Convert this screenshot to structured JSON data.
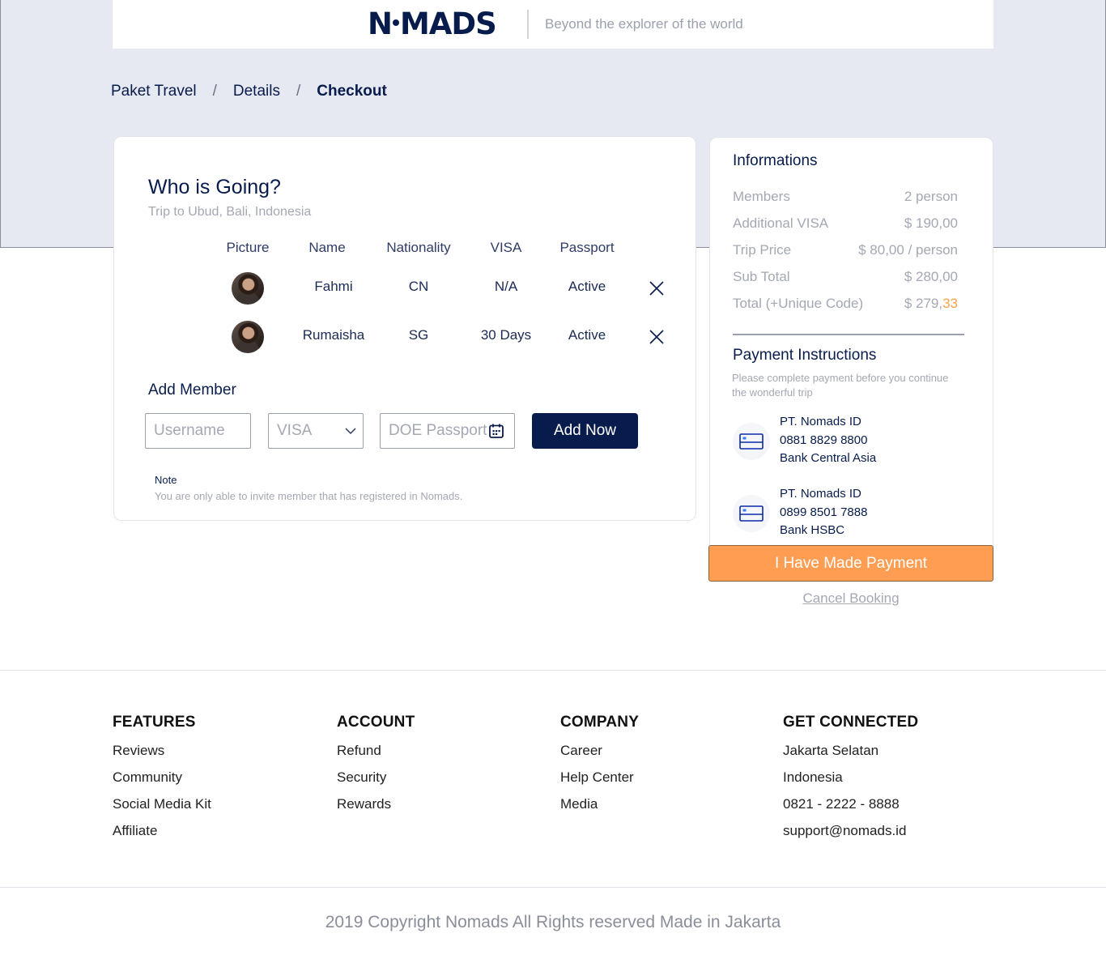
{
  "header": {
    "logo_left": "N",
    "logo_right": "MADS",
    "tagline": "Beyond the explorer of the world"
  },
  "breadcrumb": [
    "Paket Travel",
    "Details",
    "Checkout"
  ],
  "breadcrumb_sep": "/",
  "who": {
    "title": "Who is Going?",
    "subtitle": "Trip to Ubud, Bali, Indonesia",
    "columns": [
      "Picture",
      "Name",
      "Nationality",
      "VISA",
      "Passport"
    ],
    "members": [
      {
        "name": "Fahmi",
        "nationality": "CN",
        "visa": "N/A",
        "passport": "Active"
      },
      {
        "name": "Rumaisha",
        "nationality": "SG",
        "visa": "30 Days",
        "passport": "Active"
      }
    ]
  },
  "add_member": {
    "title": "Add Member",
    "username_placeholder": "Username",
    "visa_value": "VISA",
    "doe_placeholder": "DOE Passport",
    "button": "Add Now",
    "note_label": "Note",
    "note_text": "You are only able to invite member that has registered in Nomads."
  },
  "informations": {
    "title": "Informations",
    "rows": [
      {
        "label": "Members",
        "value": "2 person"
      },
      {
        "label": "Additional VISA",
        "value": "$ 190,00"
      },
      {
        "label": "Trip Price",
        "value": "$ 80,00 / person"
      },
      {
        "label": "Sub Total",
        "value": "$ 280,00"
      },
      {
        "label": "Total (+Unique Code)",
        "value": "$ 279,",
        "unique": "33"
      }
    ]
  },
  "payment": {
    "title": "Payment Instructions",
    "subtitle": "Please complete payment before you continue the wonderful trip",
    "banks": [
      {
        "holder": "PT. Nomads ID",
        "account": "0881 8829 8800",
        "bank": "Bank Central Asia"
      },
      {
        "holder": "PT. Nomads ID",
        "account": "0899 8501 7888",
        "bank": "Bank HSBC"
      }
    ],
    "pay_button": "I Have Made Payment",
    "cancel": "Cancel Booking"
  },
  "footer": {
    "features": {
      "title": "FEATURES",
      "links": [
        "Reviews",
        "Community",
        "Social Media Kit",
        "Affiliate"
      ]
    },
    "account": {
      "title": "ACCOUNT",
      "links": [
        "Refund",
        "Security",
        "Rewards"
      ]
    },
    "company": {
      "title": "COMPANY",
      "links": [
        "Career",
        "Help Center",
        "Media"
      ]
    },
    "connected": {
      "title": "GET CONNECTED",
      "links": [
        "Jakarta Selatan",
        "Indonesia",
        "0821 - 2222 - 8888",
        "support@nomads.id"
      ]
    },
    "copyright": "2019 Copyright Nomads All Rights reserved Made in Jakarta"
  },
  "colors": {
    "brand_navy": "#071c4d",
    "accent_orange": "#ff9e53",
    "muted_gray": "#a3a8b3"
  }
}
